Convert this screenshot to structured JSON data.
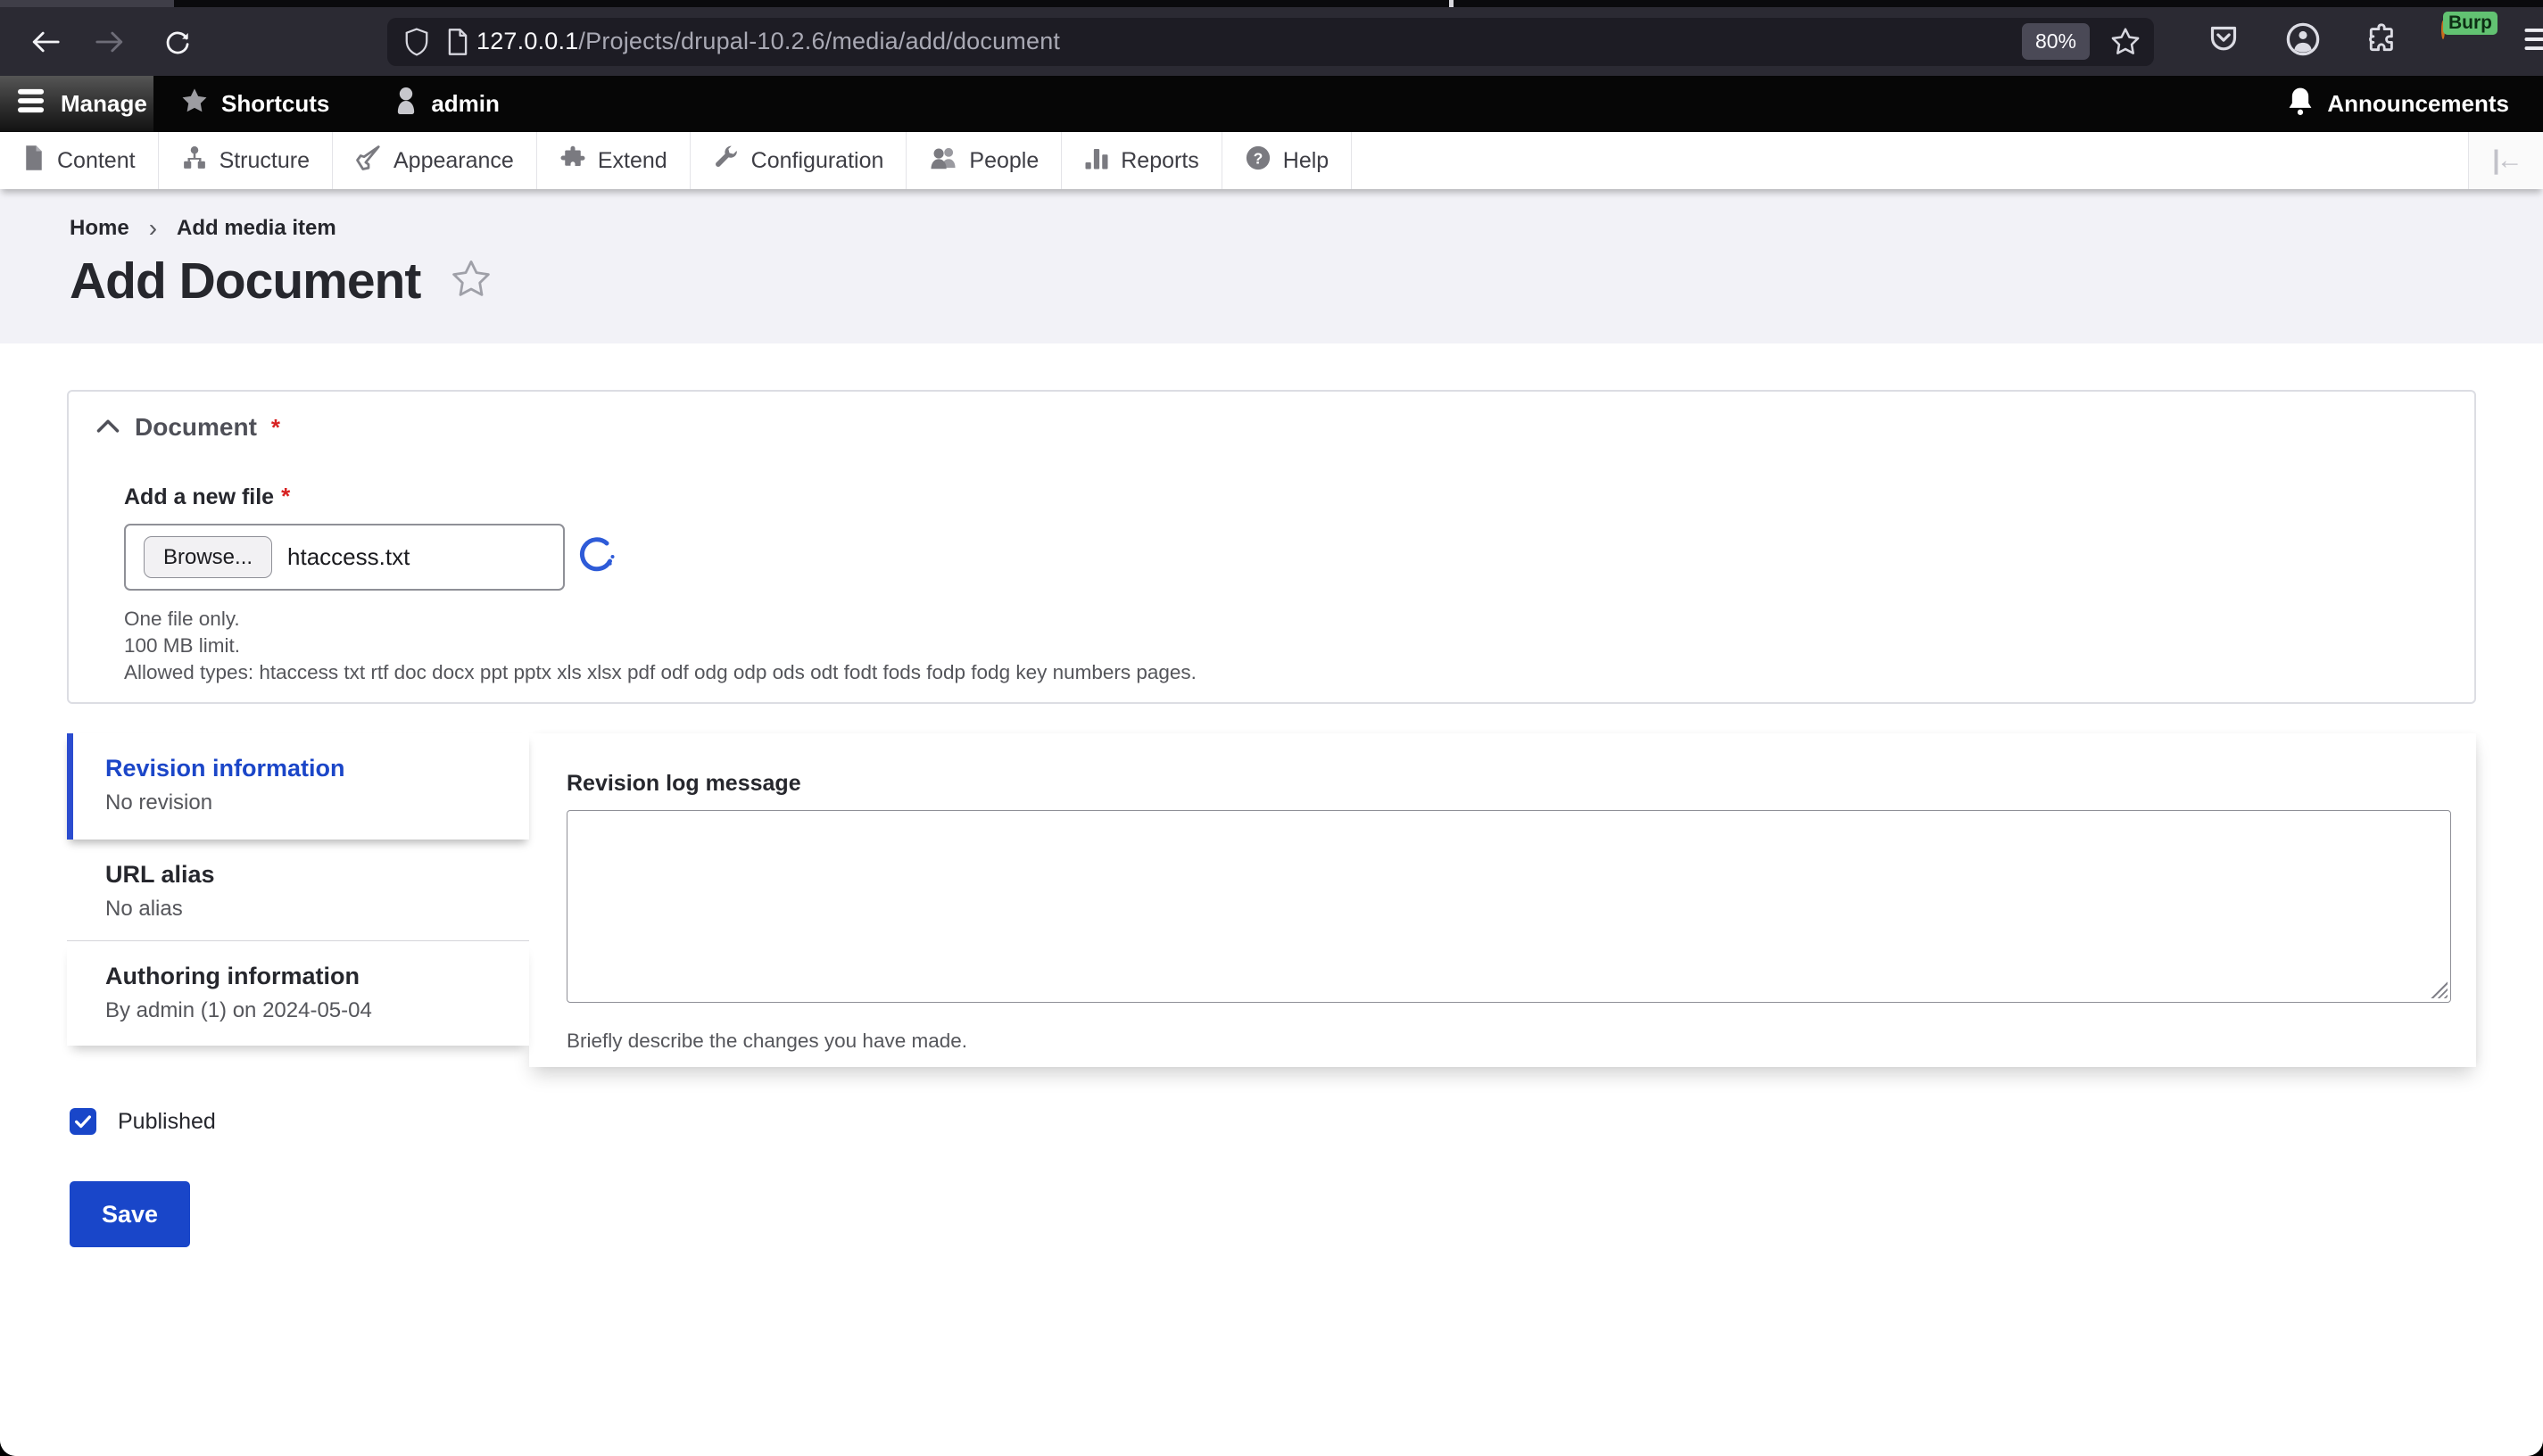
{
  "browser": {
    "url_host": "127.0.0.1",
    "url_path": "/Projects/drupal-10.2.6/media/add/document",
    "zoom_badge": "80%",
    "avatar_badge": "Burp"
  },
  "admin_toolbar": {
    "manage_label": "Manage",
    "shortcuts_label": "Shortcuts",
    "user_label": "admin",
    "announcements_label": "Announcements"
  },
  "admin_menu": {
    "items": [
      {
        "label": "Content",
        "icon": "file-icon"
      },
      {
        "label": "Structure",
        "icon": "sitemap-icon"
      },
      {
        "label": "Appearance",
        "icon": "brush-icon"
      },
      {
        "label": "Extend",
        "icon": "puzzle-icon"
      },
      {
        "label": "Configuration",
        "icon": "wrench-icon"
      },
      {
        "label": "People",
        "icon": "people-icon"
      },
      {
        "label": "Reports",
        "icon": "bar-chart-icon"
      },
      {
        "label": "Help",
        "icon": "question-icon"
      }
    ]
  },
  "breadcrumb": {
    "home": "Home",
    "separator": "›",
    "current": "Add media item"
  },
  "page": {
    "title": "Add Document"
  },
  "document_fieldset": {
    "legend": "Document",
    "required_marker": "*",
    "file_label": "Add a new file",
    "browse_button": "Browse...",
    "file_name": "htaccess.txt",
    "help_lines": [
      "One file only.",
      "100 MB limit.",
      "Allowed types: htaccess txt rtf doc docx ppt pptx xls xlsx pdf odf odg odp ods odt fodt fods fodp fodg key numbers pages."
    ]
  },
  "vertical_tabs": {
    "tabs": [
      {
        "label": "Revision information",
        "summary": "No revision",
        "active": true
      },
      {
        "label": "URL alias",
        "summary": "No alias",
        "active": false
      },
      {
        "label": "Authoring information",
        "summary": "By admin (1) on 2024-05-04",
        "active": false
      }
    ],
    "pane": {
      "label": "Revision log message",
      "description": "Briefly describe the changes you have made.",
      "textarea_value": ""
    }
  },
  "status": {
    "published_label": "Published",
    "checked": true
  },
  "actions": {
    "save_label": "Save"
  },
  "colors": {
    "accent_blue": "#1b46c8",
    "required_red": "#d72222",
    "browser_toolbar": "#2b2a33",
    "urlbar": "#1d1c24",
    "drupal_toolbar": "#060606",
    "header_bg": "#f2f2f7"
  }
}
